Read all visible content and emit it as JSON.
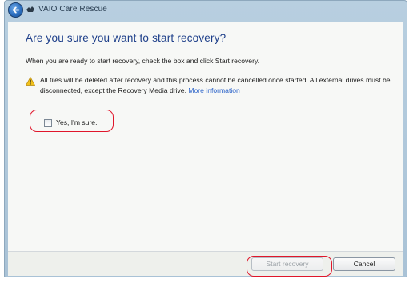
{
  "window": {
    "title": "VAIO Care Rescue"
  },
  "page": {
    "heading": "Are you sure you want to start recovery?",
    "instruction": "When you are ready to start recovery, check the box and click Start recovery.",
    "warning_icon": "warning-triangle-icon",
    "warning_text": "All files will be deleted after recovery and this process cannot be cancelled once started. All external drives must be disconnected, except the Recovery Media drive.",
    "more_info_link": "More information"
  },
  "confirm": {
    "label": "Yes, I'm sure.",
    "checked": false
  },
  "buttons": {
    "start_recovery": "Start recovery",
    "start_recovery_enabled": false,
    "cancel": "Cancel"
  },
  "colors": {
    "heading": "#1e3f8a",
    "link": "#2a62c9",
    "highlight": "#e0162b"
  }
}
